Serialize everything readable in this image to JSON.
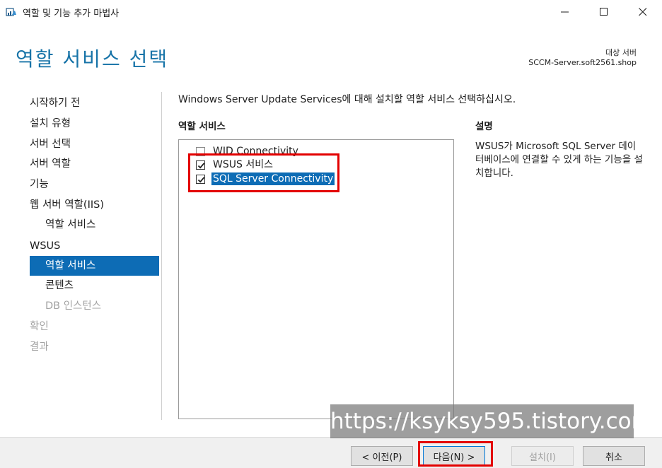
{
  "window": {
    "title": "역할 및 기능 추가 마법사",
    "icon": "server-manager-icon",
    "controls": [
      "minimize-icon",
      "maximize-icon",
      "close-icon"
    ]
  },
  "header": {
    "page_title": "역할 서비스 선택",
    "target_label": "대상 서버",
    "target_server": "SCCM-Server.soft2561.shop"
  },
  "nav": {
    "items": [
      {
        "label": "시작하기 전",
        "state": "normal"
      },
      {
        "label": "설치 유형",
        "state": "normal"
      },
      {
        "label": "서버 선택",
        "state": "normal"
      },
      {
        "label": "서버 역할",
        "state": "normal"
      },
      {
        "label": "기능",
        "state": "normal"
      },
      {
        "label": "웹 서버 역할(IIS)",
        "state": "normal"
      },
      {
        "label": "역할 서비스",
        "state": "normal"
      },
      {
        "label": "WSUS",
        "state": "normal"
      },
      {
        "label": "역할 서비스",
        "state": "selected"
      },
      {
        "label": "콘텐츠",
        "state": "normal"
      },
      {
        "label": "DB 인스턴스",
        "state": "disabled"
      },
      {
        "label": "확인",
        "state": "disabled"
      },
      {
        "label": "결과",
        "state": "disabled"
      }
    ]
  },
  "content": {
    "instruction": "Windows Server Update Services에 대해 설치할 역할 서비스 선택하십시오.",
    "services_header": "역할 서비스",
    "services": [
      {
        "label": "WID Connectivity",
        "checked": false
      },
      {
        "label": "WSUS 서비스",
        "checked": true
      },
      {
        "label": "SQL Server Connectivity",
        "checked": true,
        "highlighted": true
      }
    ],
    "description_header": "설명",
    "description": "WSUS가 Microsoft SQL Server 데이터베이스에 연결할 수 있게 하는 기능을 설치합니다."
  },
  "footer": {
    "prev_label": "< 이전(P)",
    "next_label": "다음(N) >",
    "install_label": "설치(I)",
    "cancel_label": "취소"
  },
  "watermark": "https://ksyksy595.tistory.com",
  "colors": {
    "accent": "#1874a8",
    "selection": "#0d6cb5",
    "annotation": "#e30000"
  }
}
